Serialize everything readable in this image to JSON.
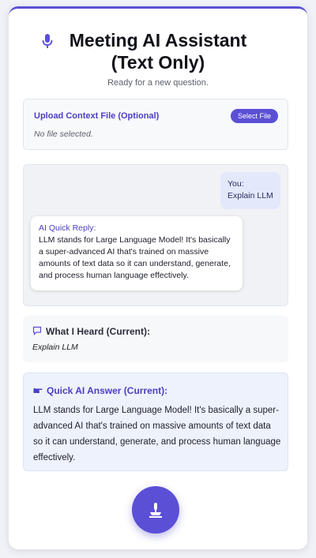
{
  "header": {
    "title_line1": "Meeting AI Assistant",
    "title_line2": "(Text Only)",
    "icon": "microphone-icon",
    "status": "Ready for a new question."
  },
  "upload": {
    "label": "Upload Context File (Optional)",
    "button_label": "Select File",
    "file_status": "No file selected."
  },
  "chat": {
    "user_label": "You:",
    "user_text": "Explain LLM",
    "ai_label": "AI Quick Reply:",
    "ai_text": "LLM stands for Large Language Model! It's basically a super-advanced AI that's trained on massive amounts of text data so it can understand, generate, and process human language effectively."
  },
  "heard": {
    "heading": "What I Heard (Current):",
    "icon": "speech-bubble-icon",
    "text": "Explain LLM"
  },
  "answer": {
    "heading": "Quick AI Answer (Current):",
    "icon": "pointing-hand-icon",
    "text": "LLM stands for Large Language Model! It's basically a super-advanced AI that's trained on massive amounts of text data so it can understand, generate, and process human language effectively."
  },
  "controls": {
    "record_icon": "microphone-stand-icon"
  },
  "colors": {
    "accent": "#5b4fd6",
    "accent_text": "#4a3fc4",
    "answer_bg": "#eef2fc",
    "user_bubble": "#e4e8fb"
  }
}
